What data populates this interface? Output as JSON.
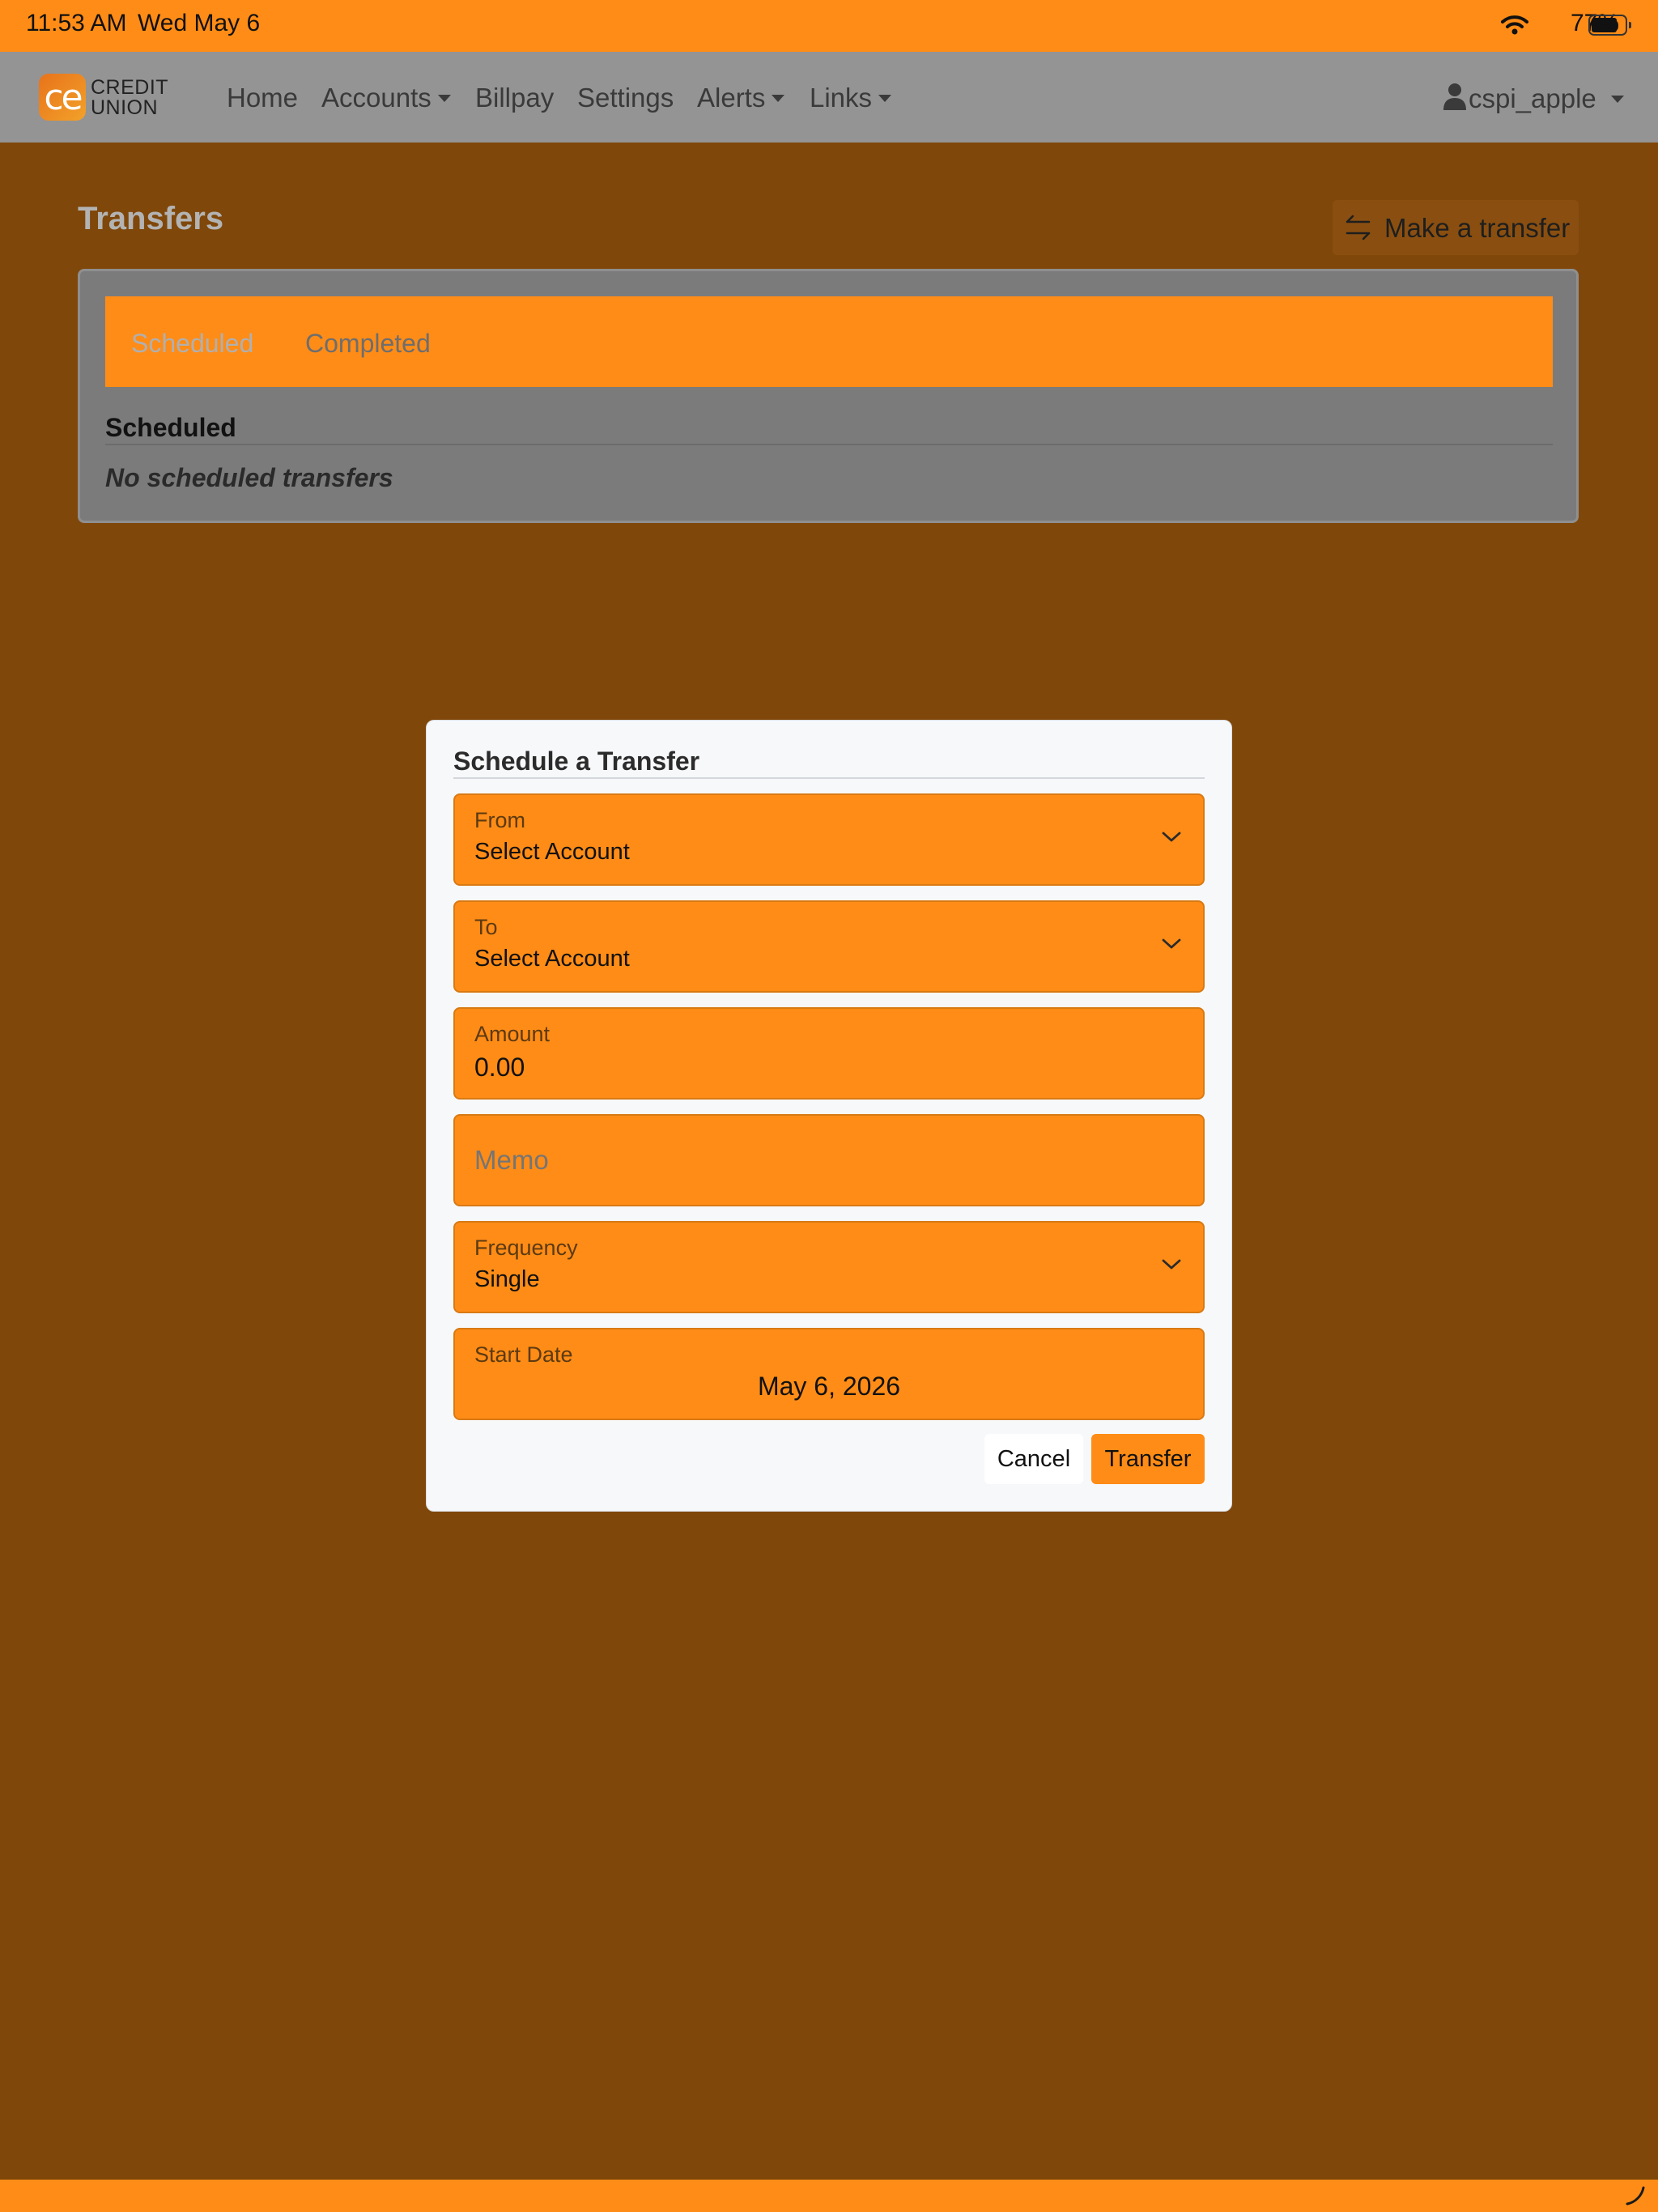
{
  "status_bar": {
    "time": "11:53 AM",
    "date": "Wed May 6",
    "battery_percent": "77%",
    "battery_level": 0.77,
    "icons": [
      "wifi-icon",
      "battery-icon"
    ]
  },
  "navbar": {
    "logo": {
      "mark": "ce",
      "line1": "CREDIT",
      "line2": "UNION"
    },
    "items": [
      {
        "label": "Home"
      },
      {
        "label": "Accounts"
      },
      {
        "label": "Billpay"
      },
      {
        "label": "Settings"
      },
      {
        "label": "Alerts"
      },
      {
        "label": "Links"
      }
    ],
    "user": {
      "name": "cspi_apple",
      "icon": "user-icon"
    }
  },
  "page": {
    "title": "Transfers",
    "make_transfer_label": "Make a transfer",
    "tabs": [
      {
        "label": "Scheduled",
        "color": "#b0b0b0"
      },
      {
        "label": "Completed",
        "color": "#6e6e6e"
      }
    ],
    "section_heading": "Scheduled",
    "empty_message": "No scheduled transfers"
  },
  "modal": {
    "title": "Schedule a Transfer",
    "fields": {
      "from": {
        "label": "From",
        "value": "Select Account"
      },
      "to": {
        "label": "To",
        "value": "Select Account"
      },
      "amount": {
        "label": "Amount",
        "value": "0.00"
      },
      "memo": {
        "placeholder": "Memo"
      },
      "frequency": {
        "label": "Frequency",
        "value": "Single"
      },
      "start_date": {
        "label": "Start Date",
        "value": "May 6, 2026"
      }
    },
    "cancel_label": "Cancel",
    "transfer_label": "Transfer"
  },
  "colors": {
    "accent": "#ff8c16",
    "overlay": "#7f470a",
    "modal_bg": "#f7f8fa"
  }
}
